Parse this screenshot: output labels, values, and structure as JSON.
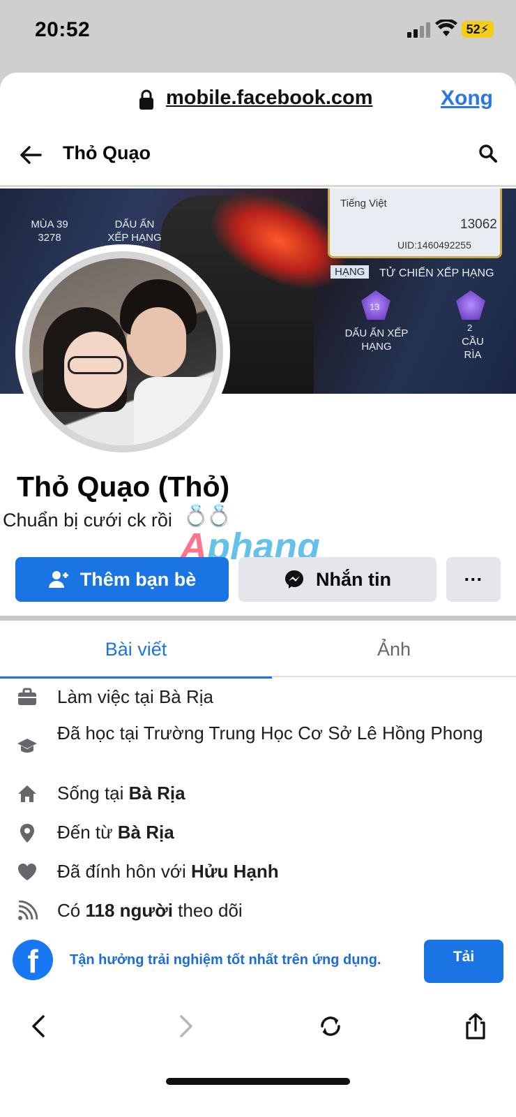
{
  "status_bar": {
    "time": "20:52",
    "battery": "52"
  },
  "browser": {
    "url": "mobile.facebook.com",
    "done_label": "Xong"
  },
  "header": {
    "title": "Thỏ Quạo"
  },
  "cover": {
    "season_label": "MÙA 39",
    "season_value": "3278",
    "rank_mark_label": "DẤU ẤN XẾP HẠNG",
    "language": "Tiếng Việt",
    "likes": "13062",
    "uid": "UID:1460492255",
    "ranked_tab_1": "HẠNG",
    "ranked_tab_2": "TỬ CHIẾN XẾP HẠNG",
    "rank_mark_label_2": "DẤU ẤN XẾP HẠNG",
    "rank_level": "13",
    "kill_label": "CẦU RÌA",
    "kill_level": "2"
  },
  "profile": {
    "name": "Thỏ Quạo (Thỏ)",
    "bio": "Chuẩn bị cưới ck rồi",
    "bio_emoji": "💍💍"
  },
  "watermark": {
    "text_pink": "A",
    "text_blue": "phang"
  },
  "actions": {
    "add_friend": "Thêm bạn bè",
    "message": "Nhắn tin",
    "more": "···"
  },
  "tabs": [
    {
      "label": "Bài viết",
      "active": true
    },
    {
      "label": "Ảnh",
      "active": false
    }
  ],
  "intro": {
    "work": {
      "prefix": "Làm việc tại Bà Rịa",
      "icon": "briefcase-icon"
    },
    "education": {
      "text": "Đã học tại Trường Trung Học Cơ Sở Lê Hồng Phong",
      "icon": "graduation-cap-icon"
    },
    "lives": {
      "prefix": "Sống tại ",
      "bold": "Bà Rịa",
      "icon": "home-icon"
    },
    "from": {
      "prefix": "Đến từ ",
      "bold": "Bà Rịa",
      "icon": "location-pin-icon"
    },
    "relationship": {
      "prefix": "Đã đính hôn với ",
      "bold": "Hửu Hạnh",
      "icon": "heart-icon"
    },
    "followers": {
      "prefix": "Có ",
      "bold": "118 người",
      "suffix": " theo dõi",
      "icon": "rss-icon"
    }
  },
  "app_banner": {
    "text": "Tận hưởng trải nghiệm tốt nhất trên ứng dụng.",
    "button": "Tải"
  },
  "colors": {
    "facebook_blue": "#1b74e4",
    "secondary_button": "#e4e6eb",
    "battery": "#f5cc16"
  }
}
